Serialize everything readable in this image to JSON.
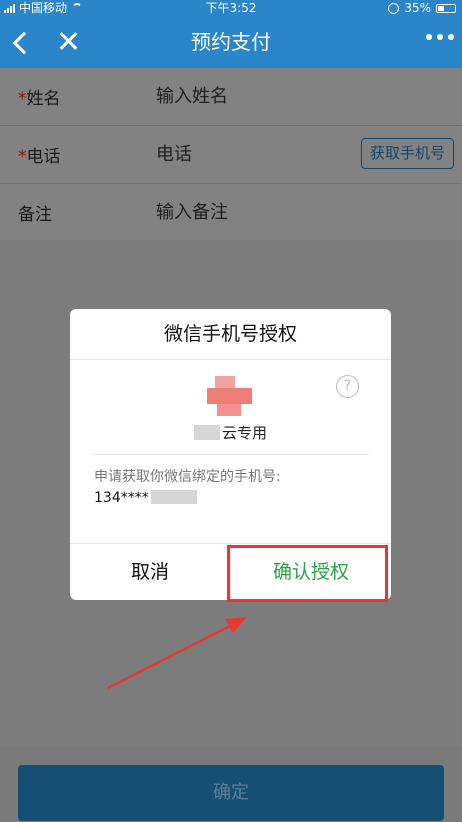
{
  "status_bar": {
    "carrier": "中国移动",
    "time": "下午3:52",
    "battery": "35%",
    "battery_level": 0.35
  },
  "nav": {
    "title": "预约支付"
  },
  "form": {
    "rows": [
      {
        "required": "*",
        "label": "姓名",
        "placeholder": "输入姓名"
      },
      {
        "required": "*",
        "label": "电话",
        "placeholder": "电话",
        "button": "获取手机号"
      },
      {
        "required": "",
        "label": "备注",
        "placeholder": "输入备注"
      }
    ]
  },
  "confirm_button": "确定",
  "dialog": {
    "title": "微信手机号授权",
    "help": "?",
    "app_name": "云专用",
    "request_text": "申请获取你微信绑定的手机号:",
    "phone_masked": "134****",
    "cancel": "取消",
    "ok": "确认授权"
  },
  "colors": {
    "accent": "#2a86c8",
    "ok_green": "#2ba245",
    "annotation_red": "#e53935"
  },
  "icons": [
    "signal-icon",
    "wifi-icon",
    "rotation-lock-icon",
    "battery-icon",
    "back-icon",
    "close-icon",
    "more-icon",
    "help-icon",
    "app-logo-icon"
  ]
}
